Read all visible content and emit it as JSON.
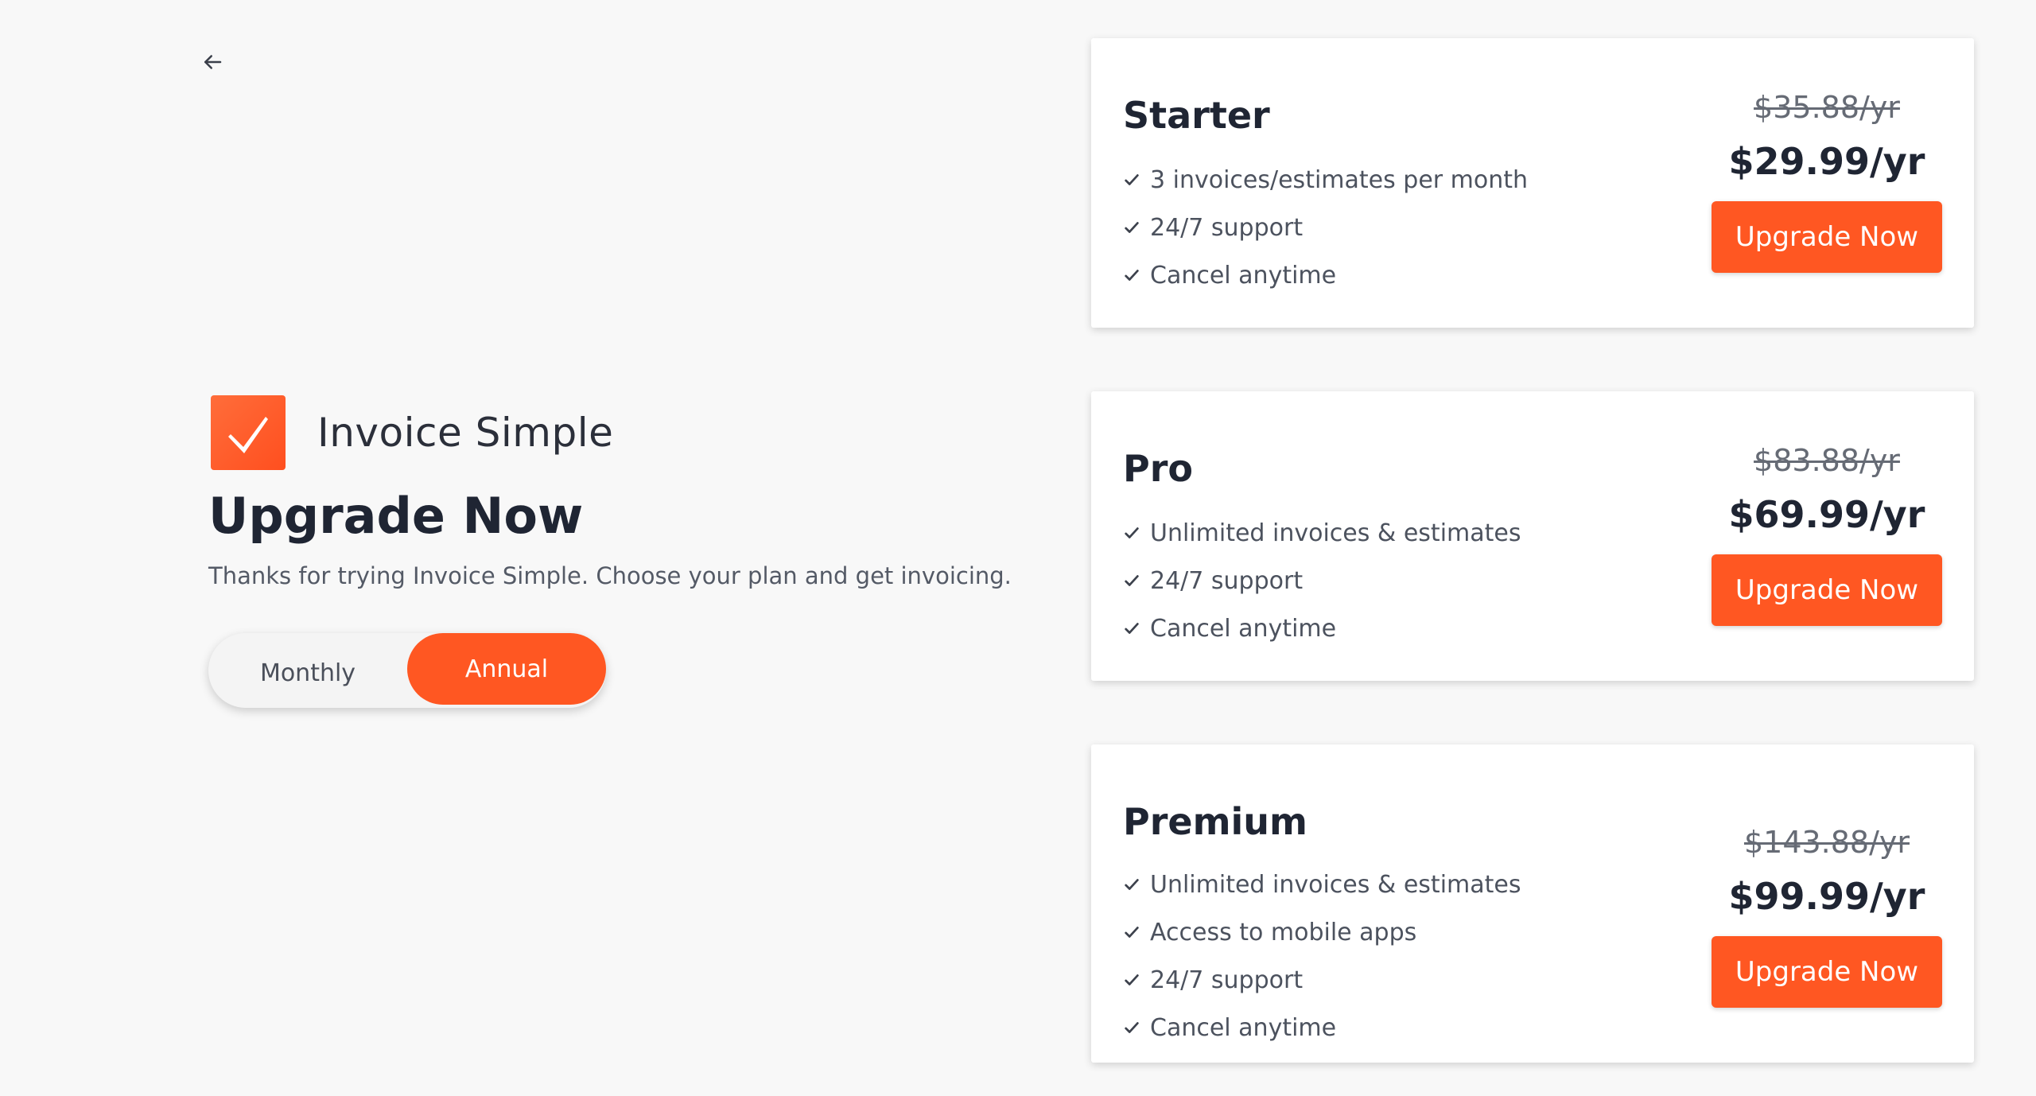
{
  "back": {
    "icon": "arrow-left-icon"
  },
  "brand": {
    "name": "Invoice Simple",
    "icon": "checkbox-logo-icon",
    "color": "#ff5722"
  },
  "header": {
    "title": "Upgrade Now",
    "subtitle": "Thanks for trying Invoice Simple. Choose your plan and get invoicing."
  },
  "billing_toggle": {
    "monthly_label": "Monthly",
    "annual_label": "Annual",
    "selected": "Annual"
  },
  "plans": [
    {
      "name": "Starter",
      "features": [
        "3 invoices/estimates per month",
        "24/7 support",
        "Cancel anytime"
      ],
      "old_price": "$35.88/yr",
      "price": "$29.99/yr",
      "button_label": "Upgrade Now"
    },
    {
      "name": "Pro",
      "features": [
        "Unlimited invoices & estimates",
        "24/7 support",
        "Cancel anytime"
      ],
      "old_price": "$83.88/yr",
      "price": "$69.99/yr",
      "button_label": "Upgrade Now"
    },
    {
      "name": "Premium",
      "features": [
        "Unlimited invoices & estimates",
        "Access to mobile apps",
        "24/7 support",
        "Cancel anytime"
      ],
      "old_price": "$143.88/yr",
      "price": "$99.99/yr",
      "button_label": "Upgrade Now"
    }
  ],
  "colors": {
    "accent": "#ff5722",
    "background": "#f8f8f8",
    "text": "#1f2533"
  }
}
